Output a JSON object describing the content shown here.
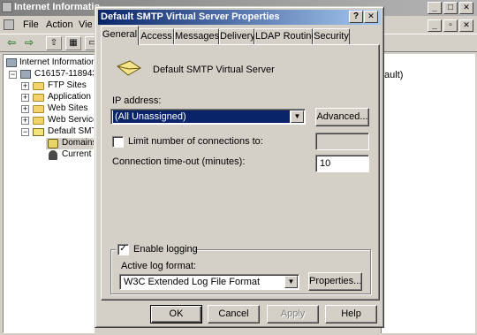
{
  "background_window": {
    "title": "Internet Informatio",
    "menu": [
      "File",
      "Action",
      "View"
    ],
    "tree": {
      "root": "Internet Information",
      "server": "C16157-118943",
      "items": [
        "FTP Sites",
        "Application P",
        "Web Sites",
        "Web Service",
        "Default SMTI"
      ],
      "children": [
        "Domains",
        "Current"
      ]
    },
    "right_pane_text": "fault)"
  },
  "dialog": {
    "title": "Default SMTP Virtual Server Properties",
    "tabs": [
      "General",
      "Access",
      "Messages",
      "Delivery",
      "LDAP Routing",
      "Security"
    ],
    "active_tab": "General",
    "server_name": "Default SMTP Virtual Server",
    "ip_address_label": "IP address:",
    "ip_address_value": "(All Unassigned)",
    "advanced_button": "Advanced...",
    "limit_connections_label": "Limit number of connections to:",
    "limit_connections_checked": false,
    "limit_connections_value": "",
    "timeout_label": "Connection time-out (minutes):",
    "timeout_value": "10",
    "enable_logging_label": "Enable logging",
    "enable_logging_checked": true,
    "log_format_label": "Active log format:",
    "log_format_value": "W3C Extended Log File Format",
    "properties_button": "Properties...",
    "ok_button": "OK",
    "cancel_button": "Cancel",
    "apply_button": "Apply",
    "help_button": "Help"
  },
  "caption_glyphs": {
    "help": "?",
    "close": "✕",
    "minimize": "_",
    "maximize": "□",
    "restore": "▫"
  }
}
